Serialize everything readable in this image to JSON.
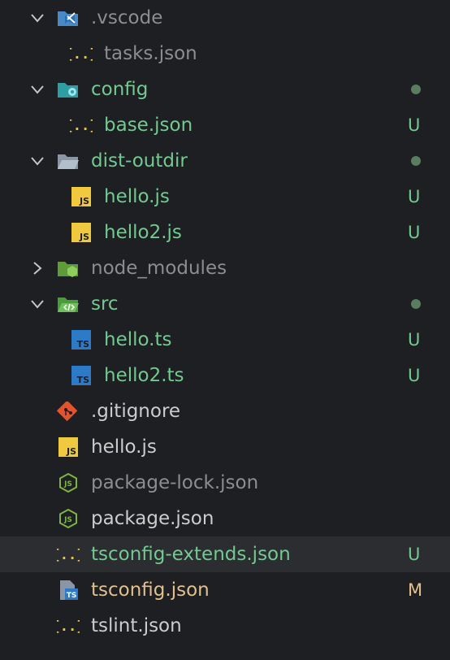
{
  "colors": {
    "background": "#1e1f22",
    "selected_row": "#2b2d31",
    "untracked_green": "#73c991",
    "modified_orange": "#e2c08d",
    "ignored_gray": "#8b8d93",
    "default_text": "#cccccc",
    "dot_green": "#5a7d62",
    "chevron": "#c5c5c5"
  },
  "tree": [
    {
      "name": ".vscode",
      "kind": "folder",
      "icon": "vscode-folder-icon",
      "expanded": true,
      "state": "ignored",
      "status": ""
    },
    {
      "name": "tasks.json",
      "kind": "file",
      "icon": "json-braces-icon",
      "state": "ignored",
      "status": ""
    },
    {
      "name": "config",
      "kind": "folder",
      "icon": "config-folder-icon",
      "expanded": true,
      "state": "untracked",
      "status": "dot"
    },
    {
      "name": "base.json",
      "kind": "file",
      "icon": "json-braces-icon",
      "state": "untracked",
      "status": "U"
    },
    {
      "name": "dist-outdir",
      "kind": "folder",
      "icon": "folder-open-icon",
      "expanded": true,
      "state": "untracked",
      "status": "dot"
    },
    {
      "name": "hello.js",
      "kind": "file",
      "icon": "js-file-icon",
      "state": "untracked",
      "status": "U"
    },
    {
      "name": "hello2.js",
      "kind": "file",
      "icon": "js-file-icon",
      "state": "untracked",
      "status": "U"
    },
    {
      "name": "node_modules",
      "kind": "folder",
      "icon": "node-folder-icon",
      "expanded": false,
      "state": "ignored",
      "status": ""
    },
    {
      "name": "src",
      "kind": "folder",
      "icon": "src-folder-icon",
      "expanded": true,
      "state": "untracked",
      "status": "dot"
    },
    {
      "name": "hello.ts",
      "kind": "file",
      "icon": "ts-file-icon",
      "state": "untracked",
      "status": "U"
    },
    {
      "name": "hello2.ts",
      "kind": "file",
      "icon": "ts-file-icon",
      "state": "untracked",
      "status": "U"
    },
    {
      "name": ".gitignore",
      "kind": "file",
      "icon": "git-icon",
      "state": "normal",
      "status": ""
    },
    {
      "name": "hello.js",
      "kind": "file",
      "icon": "js-file-icon",
      "state": "normal",
      "status": ""
    },
    {
      "name": "package-lock.json",
      "kind": "file",
      "icon": "nodejs-icon",
      "state": "ignored",
      "status": ""
    },
    {
      "name": "package.json",
      "kind": "file",
      "icon": "nodejs-icon",
      "state": "normal",
      "status": ""
    },
    {
      "name": "tsconfig-extends.json",
      "kind": "file",
      "icon": "json-braces-icon",
      "state": "untracked",
      "status": "U",
      "selected": true
    },
    {
      "name": "tsconfig.json",
      "kind": "file",
      "icon": "tsconfig-icon",
      "state": "modified",
      "status": "M"
    },
    {
      "name": "tslint.json",
      "kind": "file",
      "icon": "json-braces-icon",
      "state": "normal",
      "status": ""
    }
  ]
}
